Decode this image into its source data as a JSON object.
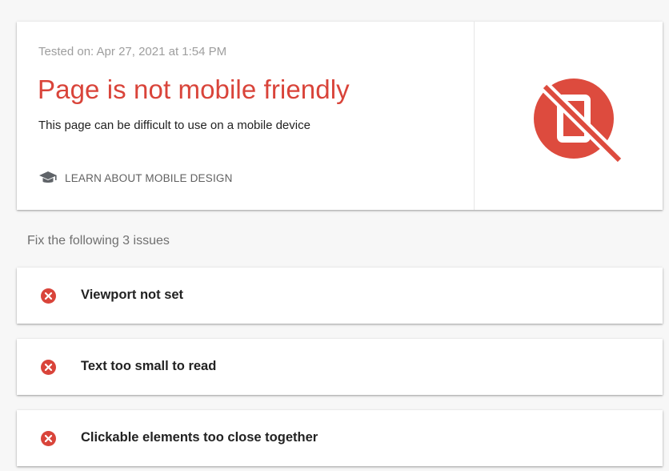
{
  "result": {
    "tested_on": "Tested on: Apr 27, 2021 at 1:54 PM",
    "headline": "Page is not mobile friendly",
    "subtext": "This page can be difficult to use on a mobile device",
    "learn_link_label": "LEARN ABOUT MOBILE DESIGN",
    "learn_link_icon": "graduation-cap-icon",
    "status_icon": "not-mobile-friendly-icon"
  },
  "issues_section": {
    "title": "Fix the following 3 issues",
    "items": [
      {
        "label": "Viewport not set",
        "icon": "error-icon"
      },
      {
        "label": "Text too small to read",
        "icon": "error-icon"
      },
      {
        "label": "Clickable elements too close together",
        "icon": "error-icon"
      }
    ]
  },
  "colors": {
    "error": "#d9443a",
    "background": "#f7f7f7",
    "card": "#ffffff",
    "muted_text": "#9e9e9e"
  }
}
